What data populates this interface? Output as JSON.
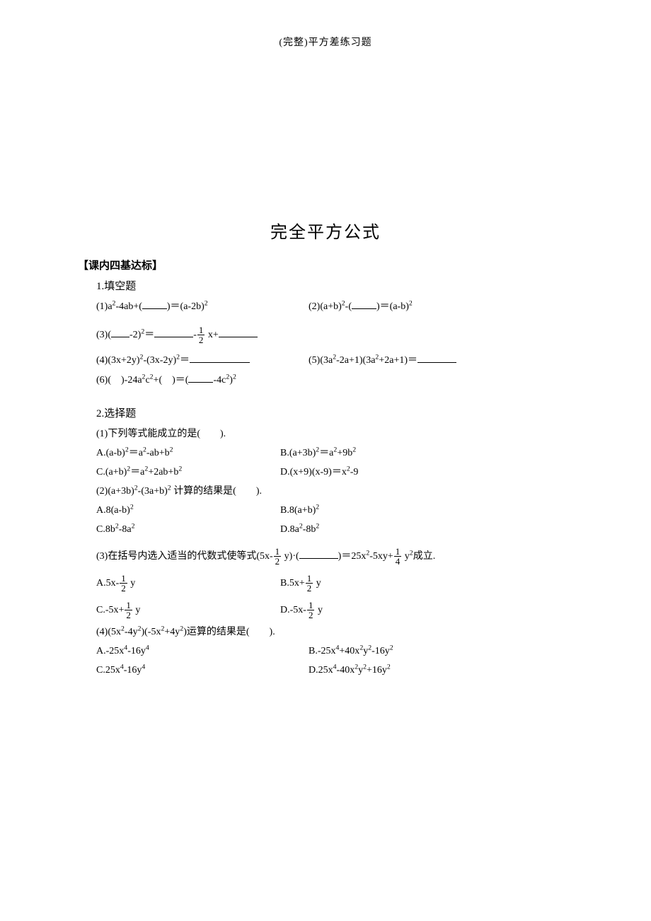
{
  "header": "(完整)平方差练习题",
  "title": "完全平方公式",
  "sectionHeader": "【课内四基达标】",
  "q1": {
    "title": "1.填空题",
    "p1a": "(1)a",
    "p1b": "-4ab+(",
    "p1c": ")＝(a-2b)",
    "p2a": "(2)(a+b)",
    "p2b": "-(",
    "p2c": ")＝(a-b)",
    "p3a": "(3)(",
    "p3b": "-2)",
    "p3c": "＝",
    "p3d": "-",
    "p3num": "1",
    "p3den": "2",
    "p3e": " x+",
    "p4a": "(4)(3x+2y)",
    "p4b": "-(3x-2y)",
    "p4c": "＝",
    "p5a": "(5)(3a",
    "p5b": "-2a+1)(3a",
    "p5c": "+2a+1)＝",
    "p6a": "(6)(",
    "p6b": ")-24a",
    "p6c": "c",
    "p6d": "+(",
    "p6e": ")＝(",
    "p6f": "-4c",
    "p6g": ")"
  },
  "q2": {
    "title": "2.选择题",
    "p1q": "(1)下列等式能成立的是(　　).",
    "p1a1": "A.(a-b)",
    "p1a2": "＝a",
    "p1a3": "-ab+b",
    "p1b1": "B.(a+3b)",
    "p1b2": "＝a",
    "p1b3": "+9b",
    "p1c1": "C.(a+b)",
    "p1c2": "＝a",
    "p1c3": "+2ab+b",
    "p1d1": "D.(x+9)(x-9)＝x",
    "p1d2": "-9",
    "p2q1": "(2)(a+3b)",
    "p2q2": "-(3a+b)",
    "p2q3": " 计算的结果是(　　).",
    "p2a": "A.8(a-b)",
    "p2b": "B.8(a+b)",
    "p2c": "C.8b",
    "p2c2": "-8a",
    "p2d": "D.8a",
    "p2d2": "-8b",
    "p3q1": "(3)在括号内选入适当的代数式使等式(5x-",
    "p3num1": "1",
    "p3den1": "2",
    "p3q2": " y)·(",
    "p3q3": ")＝25x",
    "p3q4": "-5xy+",
    "p3num2": "1",
    "p3den2": "4",
    "p3q5": " y",
    "p3q6": "成立.",
    "p3a1": "A.5x-",
    "p3a2": " y",
    "p3b1": "B.5x+",
    "p3b2": " y",
    "p3c1": "C.-5x+",
    "p3c2": " y",
    "p3d1": "D.-5x-",
    "p3d2": " y",
    "p3onum": "1",
    "p3oden": "2",
    "p4q1": "(4)(5x",
    "p4q2": "-4y",
    "p4q3": ")(-5x",
    "p4q4": "+4y",
    "p4q5": ")运算的结果是(　　).",
    "p4a1": "A.-25x",
    "p4a2": "-16y",
    "p4b1": "B.-25x",
    "p4b2": "+40x",
    "p4b3": "y",
    "p4b4": "-16y",
    "p4c1": "C.25x",
    "p4c2": "-16y",
    "p4d1": "D.25x",
    "p4d2": "-40x",
    "p4d3": "y",
    "p4d4": "+16y"
  },
  "sup2": "2",
  "sup4": "4"
}
